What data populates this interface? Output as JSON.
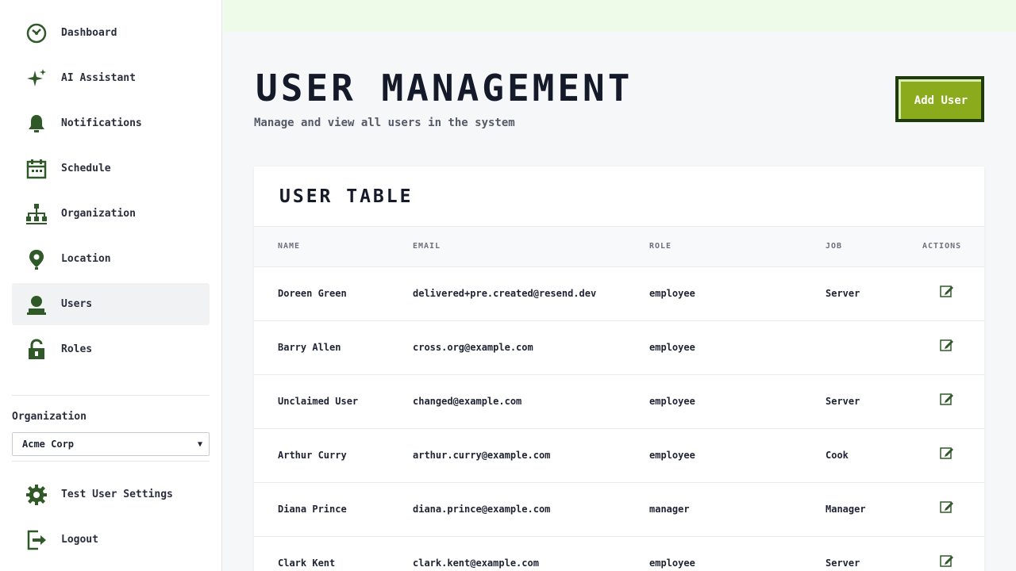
{
  "sidebar": {
    "items": [
      {
        "label": "Dashboard",
        "icon": "dashboard-icon"
      },
      {
        "label": "AI Assistant",
        "icon": "sparkle-icon"
      },
      {
        "label": "Notifications",
        "icon": "bell-icon"
      },
      {
        "label": "Schedule",
        "icon": "calendar-icon"
      },
      {
        "label": "Organization",
        "icon": "org-chart-icon"
      },
      {
        "label": "Location",
        "icon": "map-pin-icon"
      },
      {
        "label": "Users",
        "icon": "user-icon",
        "active": true
      },
      {
        "label": "Roles",
        "icon": "lock-icon"
      }
    ],
    "org_label": "Organization",
    "org_selected": "Acme Corp",
    "bottom": [
      {
        "label": "Test User Settings",
        "icon": "gear-icon"
      },
      {
        "label": "Logout",
        "icon": "logout-icon"
      }
    ]
  },
  "header": {
    "title": "User Management",
    "subtitle": "Manage and view all users in the system",
    "add_button": "Add User"
  },
  "table": {
    "title": "User Table",
    "columns": [
      "Name",
      "Email",
      "Role",
      "Job",
      "Actions"
    ],
    "rows": [
      {
        "name": "Doreen Green",
        "email": "delivered+pre.created@resend.dev",
        "role": "employee",
        "job": "Server"
      },
      {
        "name": "Barry Allen",
        "email": "cross.org@example.com",
        "role": "employee",
        "job": ""
      },
      {
        "name": "Unclaimed User",
        "email": "changed@example.com",
        "role": "employee",
        "job": "Server"
      },
      {
        "name": "Arthur Curry",
        "email": "arthur.curry@example.com",
        "role": "employee",
        "job": "Cook"
      },
      {
        "name": "Diana Prince",
        "email": "diana.prince@example.com",
        "role": "manager",
        "job": "Manager"
      },
      {
        "name": "Clark Kent",
        "email": "clark.kent@example.com",
        "role": "employee",
        "job": "Server"
      }
    ]
  },
  "colors": {
    "icon_green": "#2f5a28",
    "accent_green": "#8bab1d",
    "accent_dark": "#1f3b0e",
    "topbar": "#effbe9"
  }
}
